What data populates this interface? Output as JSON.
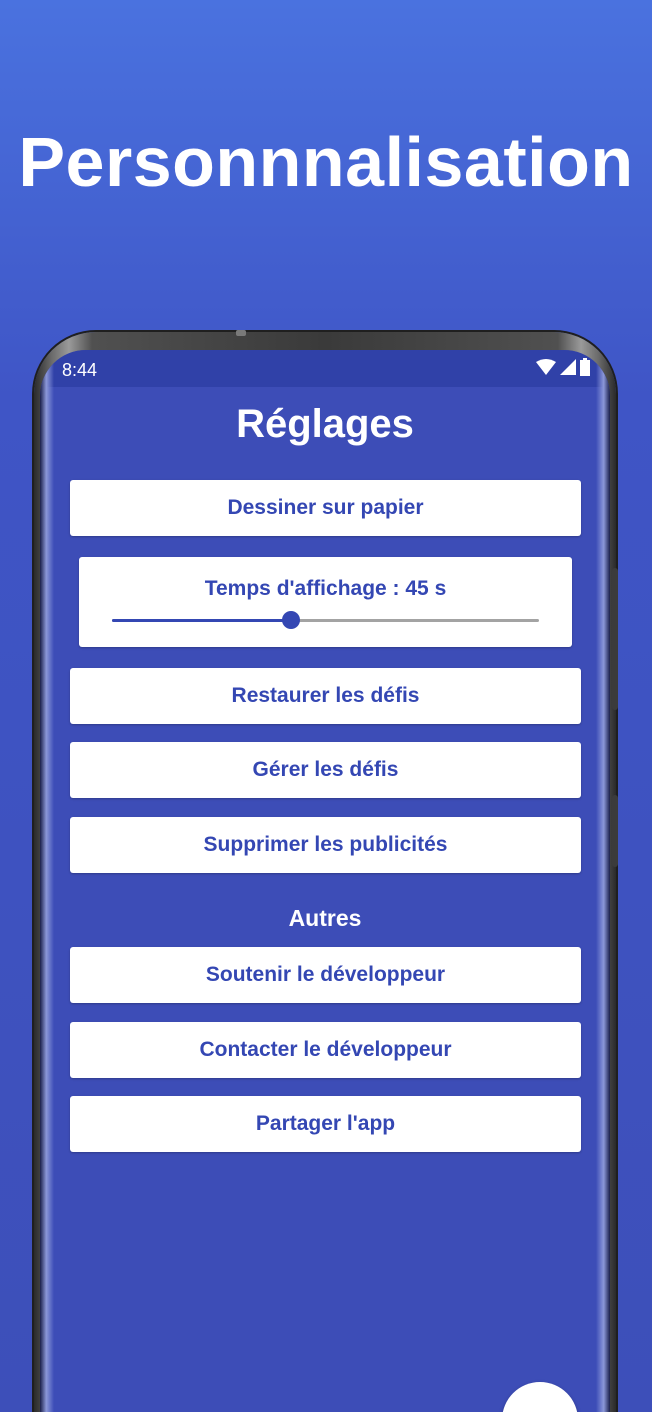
{
  "promo": {
    "title": "Personnnalisation"
  },
  "status_bar": {
    "time": "8:44",
    "icons": [
      "wifi-icon",
      "signal-icon",
      "battery-icon"
    ]
  },
  "settings": {
    "title": "Réglages",
    "buttons": {
      "draw_on_paper": "Dessiner sur papier",
      "restore_challenges": "Restaurer les défis",
      "manage_challenges": "Gérer les défis",
      "remove_ads": "Supprimer les publicités"
    },
    "display_time": {
      "label": "Temps d'affichage : 45 s",
      "slider_fraction": 0.42
    },
    "others_header": "Autres",
    "other_buttons": {
      "support_developer": "Soutenir le développeur",
      "contact_developer": "Contacter le développeur",
      "share_app": "Partager l'app"
    }
  },
  "colors": {
    "accent": "#3447b3",
    "screen_background": "#3d4db7",
    "status_bar": "#3041a8"
  }
}
